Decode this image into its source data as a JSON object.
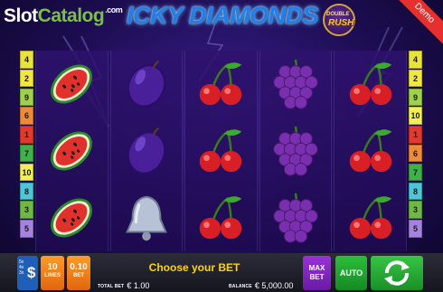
{
  "header": {
    "watermark_slot": "Slot",
    "watermark_catalog": "Catalog",
    "watermark_com": ".com",
    "game_title": "ICKY DIAMONDS",
    "badge_small": "DOUBLE",
    "badge_big": "RUSH",
    "demo_label": "Demo"
  },
  "paylines": {
    "left": [
      {
        "n": "4",
        "color": "#e8e23a"
      },
      {
        "n": "2",
        "color": "#f2e640"
      },
      {
        "n": "9",
        "color": "#9fd24a"
      },
      {
        "n": "6",
        "color": "#ee8a3a"
      },
      {
        "n": "1",
        "color": "#e03a2f"
      },
      {
        "n": "7",
        "color": "#3fb04a"
      },
      {
        "n": "10",
        "color": "#f2ee5a"
      },
      {
        "n": "8",
        "color": "#4cc6d8"
      },
      {
        "n": "3",
        "color": "#6fb844"
      },
      {
        "n": "5",
        "color": "#a682e0"
      }
    ],
    "right": [
      {
        "n": "4",
        "color": "#e8e23a"
      },
      {
        "n": "2",
        "color": "#f2e640"
      },
      {
        "n": "9",
        "color": "#9fd24a"
      },
      {
        "n": "10",
        "color": "#f2ee5a"
      },
      {
        "n": "1",
        "color": "#e03a2f"
      },
      {
        "n": "6",
        "color": "#ee8a3a"
      },
      {
        "n": "7",
        "color": "#3fb04a"
      },
      {
        "n": "8",
        "color": "#4cc6d8"
      },
      {
        "n": "3",
        "color": "#6fb844"
      },
      {
        "n": "5",
        "color": "#a682e0"
      }
    ]
  },
  "reels": [
    [
      "watermelon",
      "watermelon",
      "watermelon"
    ],
    [
      "plum",
      "plum",
      "bell"
    ],
    [
      "cherry",
      "cherry",
      "cherry"
    ],
    [
      "grapes",
      "grapes",
      "grapes"
    ],
    [
      "cherry",
      "cherry",
      "cherry"
    ]
  ],
  "bottom": {
    "paytable_lines": [
      "5x",
      "4x",
      "3x"
    ],
    "paytable_symbol": "$",
    "lines_value": "10",
    "lines_label": "LINES",
    "bet_value": "0.10",
    "bet_label": "BET",
    "message": "Choose your BET",
    "total_bet_label": "TOTAL BET",
    "total_bet_value": "€ 1.00",
    "balance_label": "BALANCE",
    "balance_value": "€ 5,000.00",
    "maxbet_line1": "MAX",
    "maxbet_line2": "BET",
    "auto_label": "AUTO"
  },
  "colors": {
    "background": "#1d0d52",
    "accent_orange": "#f08a1e",
    "accent_purple": "#8a2bc8",
    "accent_green": "#22a832",
    "message_yellow": "#ffd400"
  }
}
